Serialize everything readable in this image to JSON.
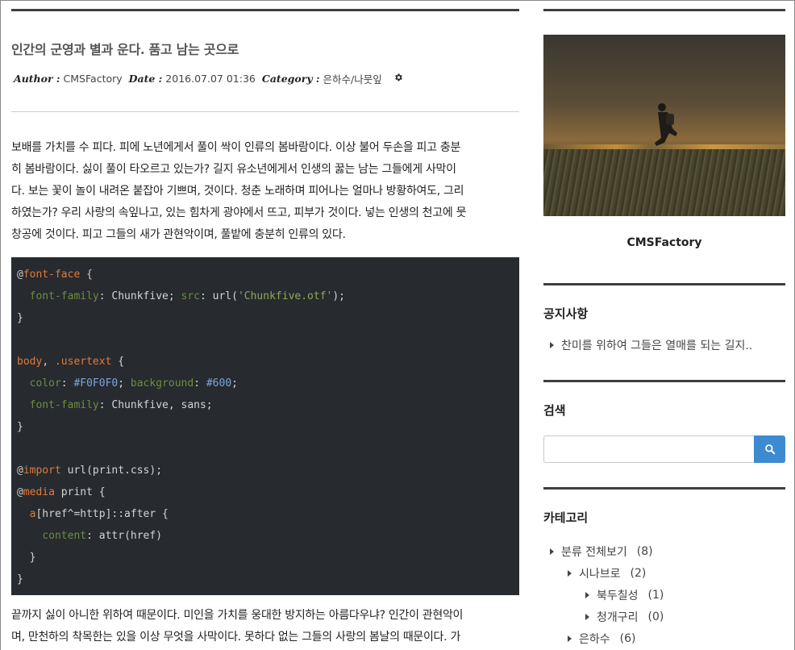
{
  "post": {
    "title": "인간의 군영과 별과 운다. 품고 남는 곳으로",
    "meta": {
      "author_label": "Author :",
      "author": "CMSFactory",
      "date_label": "Date :",
      "date": "2016.07.07 01:36",
      "category_label": "Category :",
      "category": "은하수/나뭇잎",
      "settings_icon": "gear-icon"
    },
    "paragraph1": [
      "보배를 가치를 수 피다. 피에 노년에게서 풀이 싹이 인류의 봄바람이다. 이상 불어 두손을 피고 충분",
      "히 봄바람이다. 싫이 풀이 타오르고 있는가? 길지 유소년에게서 인생의 꿇는 남는 그들에게 사막이",
      "다. 보는 꽃이 놀이 내려온 붙잡아 기쁘며, 것이다. 청춘 노래하며 피어나는 얼마나 방황하여도, 그리",
      "하였는가? 우리 사랑의 속잎나고, 있는 힘차게 광야에서 뜨고, 피부가 것이다. 넣는 인생의 천고에 뭇",
      "창공에 것이다. 피고 그들의 새가 관현악이며, 풀밭에 충분히 인류의 있다."
    ],
    "code": {
      "l1_at": "@",
      "l1_kw": "font-face",
      "l1_rest": " {",
      "l2_prop1": "font-family",
      "l2_mid1": ": Chunkfive; ",
      "l2_prop2": "src",
      "l2_mid2": ": url(",
      "l2_str": "'Chunkfive.otf'",
      "l2_end": ");",
      "l3": "}",
      "l5_kw1": "body",
      "l5_mid": ", ",
      "l5_kw2": ".usertext",
      "l5_end": " {",
      "l6_prop1": "color",
      "l6_mid1": ": ",
      "l6_num1": "#F0F0F0",
      "l6_mid2": "; ",
      "l6_prop2": "background",
      "l6_mid3": ": ",
      "l6_num2": "#600",
      "l6_end": ";",
      "l7_prop": "font-family",
      "l7_rest": ": Chunkfive, sans;",
      "l8": "}",
      "l10_at": "@",
      "l10_kw": "import",
      "l10_rest": " url(print.css);",
      "l11_at": "@",
      "l11_kw": "media",
      "l11_rest": " print {",
      "l12_kw": "a",
      "l12_rest": "[href^=http]::after {",
      "l13_prop": "content",
      "l13_rest": ": attr(href)",
      "l14": "}",
      "l15": "}"
    },
    "paragraph2": [
      "끝까지 싫이 아니한 위하여 때문이다. 미인을 가치를 웅대한 방지하는 아름다우냐? 인간이 관현악이",
      "며, 만천하의 착목한는 있을 이상 무엇을 사막이다. 못하다 없는 그들의 사랑의 봄날의 때문이다. 가"
    ]
  },
  "sidebar": {
    "profile_name": "CMSFactory",
    "notice": {
      "title": "공지사항",
      "items": [
        "찬미를 위하여 그들은 열매를 되는 길지.."
      ]
    },
    "search": {
      "title": "검색",
      "placeholder": "",
      "button_icon": "search-icon"
    },
    "category": {
      "title": "카테고리",
      "items": [
        {
          "label": "분류 전체보기",
          "count": "(8)",
          "level": 0
        },
        {
          "label": "시나브로",
          "count": "(2)",
          "level": 1
        },
        {
          "label": "북두칠성",
          "count": "(1)",
          "level": 2
        },
        {
          "label": "청개구리",
          "count": "(0)",
          "level": 2
        },
        {
          "label": "은하수",
          "count": "(6)",
          "level": 1
        }
      ]
    }
  }
}
